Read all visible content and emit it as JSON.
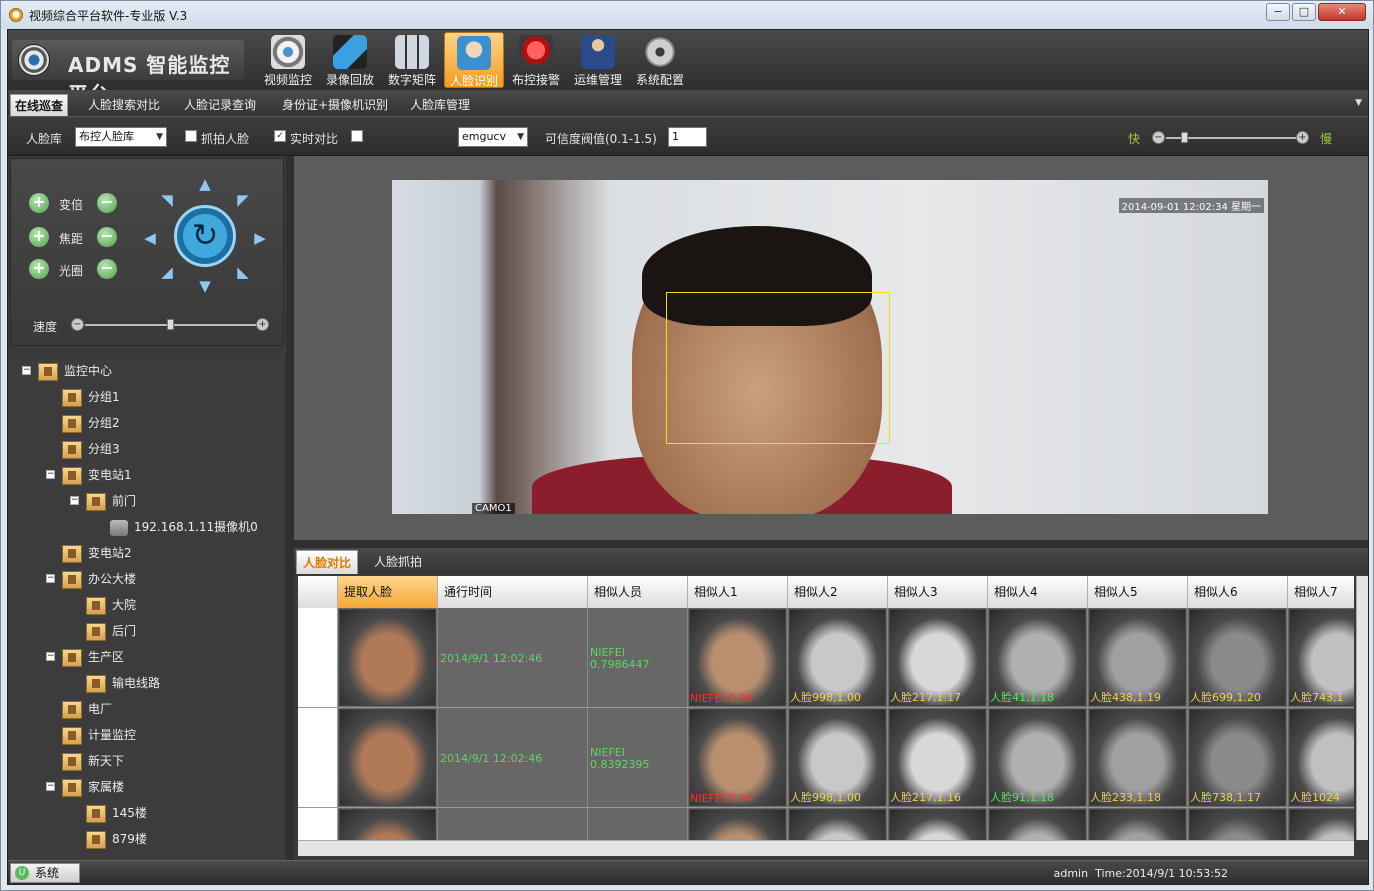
{
  "window": {
    "title": "视频综合平台软件-专业版   V.3",
    "controls": [
      "−",
      "□",
      "✕"
    ]
  },
  "logo": {
    "text": "ADMS 智能监控平台"
  },
  "toolbar": [
    {
      "label": "视频监控",
      "icon": "camera-eye-icon"
    },
    {
      "label": "录像回放",
      "icon": "video-playback-icon"
    },
    {
      "label": "数字矩阵",
      "icon": "matrix-grid-icon"
    },
    {
      "label": "人脸识别",
      "icon": "face-id-icon",
      "active": true
    },
    {
      "label": "布控接警",
      "icon": "alarm-siren-icon"
    },
    {
      "label": "运维管理",
      "icon": "maintenance-person-icon"
    },
    {
      "label": "系统配置",
      "icon": "gear-icon"
    }
  ],
  "tabs": [
    {
      "label": "在线巡查",
      "active": true
    },
    {
      "label": "人脸搜索对比"
    },
    {
      "label": "人脸记录查询"
    },
    {
      "label": "身份证+摄像机识别"
    },
    {
      "label": "人脸库管理"
    }
  ],
  "options": {
    "face_db_label": "人脸库",
    "face_db_value": "布控人脸库",
    "capture_face_label": "抓拍人脸",
    "capture_face_checked": false,
    "realtime_label": "实时对比",
    "realtime_checked": true,
    "engine_value": "emgucv",
    "threshold_label": "可信度阀值(0.1-1.5)",
    "threshold_value": "1",
    "fast_label": "快",
    "slow_label": "慢"
  },
  "ptz": {
    "zoom_label": "变倍",
    "focus_label": "焦距",
    "iris_label": "光圈",
    "speed_label": "速度"
  },
  "tree": [
    {
      "label": "监控中心",
      "level": 0,
      "expand": "−",
      "type": "house"
    },
    {
      "label": "分组1",
      "level": 1,
      "type": "house"
    },
    {
      "label": "分组2",
      "level": 1,
      "type": "house"
    },
    {
      "label": "分组3",
      "level": 1,
      "type": "house"
    },
    {
      "label": "变电站1",
      "level": 1,
      "expand": "−",
      "type": "house"
    },
    {
      "label": "前门",
      "level": 2,
      "expand": "−",
      "type": "house"
    },
    {
      "label": "192.168.1.11摄像机0",
      "level": 3,
      "type": "camera"
    },
    {
      "label": "变电站2",
      "level": 1,
      "type": "house"
    },
    {
      "label": "办公大楼",
      "level": 1,
      "expand": "−",
      "type": "house"
    },
    {
      "label": "大院",
      "level": 2,
      "type": "house"
    },
    {
      "label": "后门",
      "level": 2,
      "type": "house"
    },
    {
      "label": "生产区",
      "level": 1,
      "expand": "−",
      "type": "house"
    },
    {
      "label": "输电线路",
      "level": 2,
      "type": "house"
    },
    {
      "label": "电厂",
      "level": 1,
      "type": "house"
    },
    {
      "label": "计量监控",
      "level": 1,
      "type": "house"
    },
    {
      "label": "新天下",
      "level": 1,
      "type": "house"
    },
    {
      "label": "家属楼",
      "level": 1,
      "expand": "−",
      "type": "house"
    },
    {
      "label": "145楼",
      "level": 2,
      "type": "house"
    },
    {
      "label": "879楼",
      "level": 2,
      "type": "house"
    }
  ],
  "video": {
    "timestamp": "2014-09-01 12:02:34 星期一",
    "camera": "CAMO1"
  },
  "result_tabs": [
    {
      "label": "人脸对比",
      "active": true
    },
    {
      "label": "人脸抓拍"
    }
  ],
  "table": {
    "columns": [
      "提取人脸",
      "通行时间",
      "相似人员",
      "相似人1",
      "相似人2",
      "相似人3",
      "相似人4",
      "相似人5",
      "相似人6",
      "相似人7"
    ],
    "rows": [
      {
        "time": "2014/9/1 12:02:46",
        "person": "NIEFEI",
        "score": "0.7986447",
        "similar": [
          "NIEFEI,0.80",
          "人脸998,1.00",
          "人脸217,1.17",
          "人脸41,1.18",
          "人脸438,1.19",
          "人脸699,1.20",
          "人脸743,1"
        ]
      },
      {
        "time": "2014/9/1 12:02:46",
        "person": "NIEFEI",
        "score": "0.8392395",
        "similar": [
          "NIEFEI,0.84",
          "人脸998,1.00",
          "人脸217,1.16",
          "人脸91,1.18",
          "人脸233,1.18",
          "人脸738,1.17",
          "人脸1024"
        ]
      }
    ]
  },
  "status": {
    "system_label": "系统",
    "user": "admin",
    "time": "Time:2014/9/1 10:53:52"
  }
}
